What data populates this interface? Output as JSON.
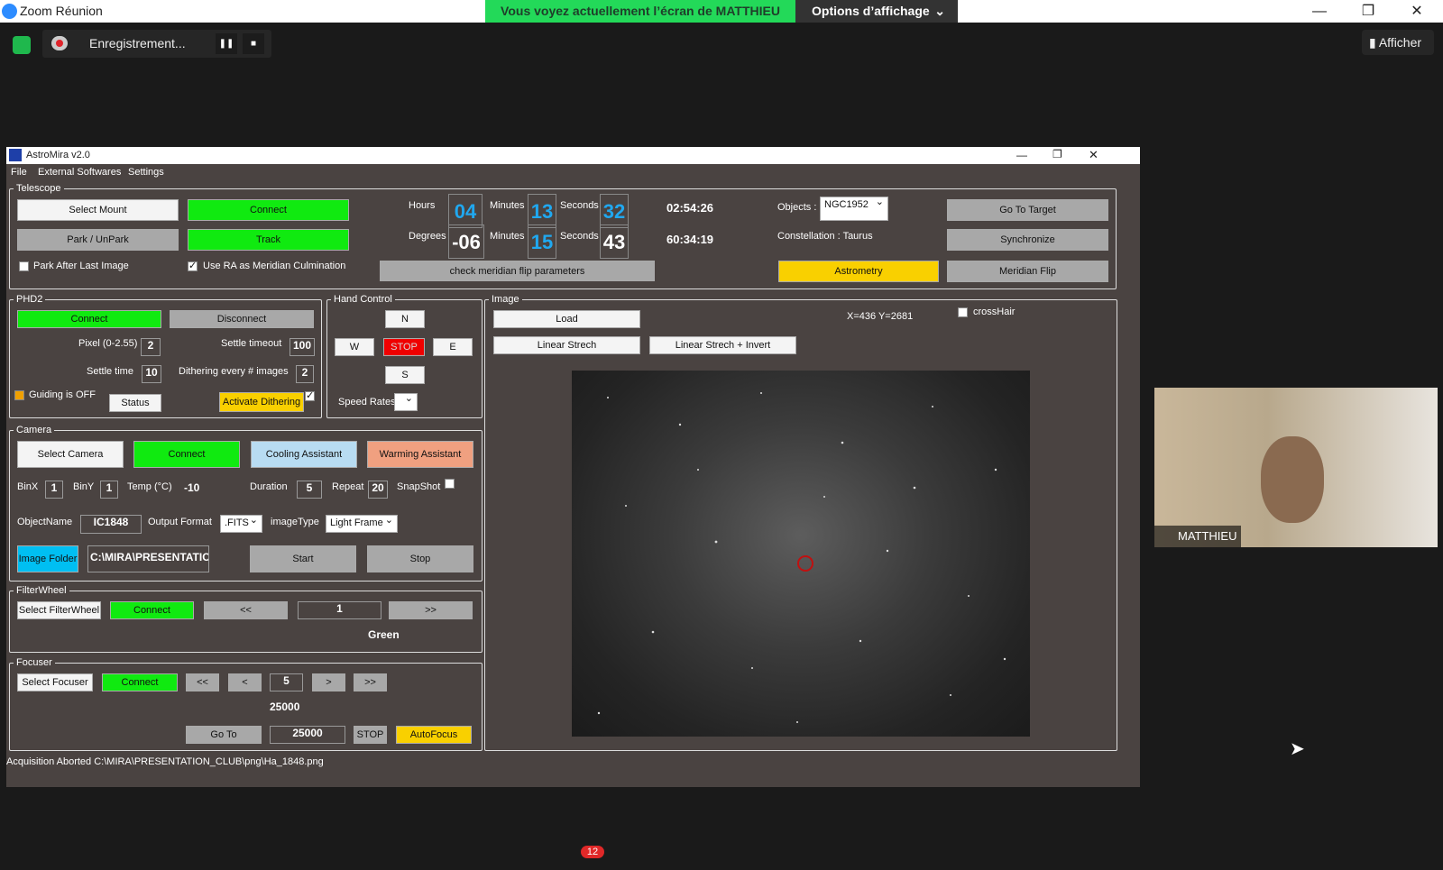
{
  "zoom": {
    "title": "Zoom Réunion",
    "banner": "Vous voyez actuellement l’écran de MATTHIEU",
    "options": "Options d’affichage",
    "recording": "Enregistrement...",
    "afficher": "Afficher",
    "participant": "MATTHIEU",
    "chat_badge": "12"
  },
  "app": {
    "title": "AstroMira v2.0",
    "menu": [
      "File",
      "External Softwares",
      "Settings"
    ],
    "telescope": {
      "legend": "Telescope",
      "select_mount": "Select Mount",
      "connect": "Connect",
      "park": "Park / UnPark",
      "track": "Track",
      "park_after": "Park After Last Image",
      "use_ra": "Use RA as Meridian Culmination",
      "hours_lbl": "Hours",
      "hours": "04",
      "minutes_lbl": "Minutes",
      "minutes": "13",
      "seconds_lbl": "Seconds",
      "seconds": "32",
      "degrees_lbl": "Degrees",
      "degrees": "-06",
      "dminutes": "15",
      "dseconds": "43",
      "ra": "02:54:26",
      "dec": "60:34:19",
      "check_flip": "check meridian flip parameters",
      "objects_lbl": "Objects :",
      "object": "NGC1952",
      "constellation": "Constellation : Taurus",
      "astrometry": "Astrometry",
      "goto_target": "Go To Target",
      "synchronize": "Synchronize",
      "meridian_flip": "Meridian Flip"
    },
    "phd2": {
      "legend": "PHD2",
      "connect": "Connect",
      "disconnect": "Disconnect",
      "pixel_lbl": "Pixel (0-2.55)",
      "pixel": "2",
      "settle_timeout_lbl": "Settle timeout",
      "settle_timeout": "100",
      "settle_time_lbl": "Settle time",
      "settle_time": "10",
      "dither_lbl": "Dithering every # images",
      "dither": "2",
      "guiding": "Guiding is OFF",
      "status": "Status",
      "activate_dither": "Activate Dithering"
    },
    "hand": {
      "legend": "Hand Control",
      "n": "N",
      "w": "W",
      "stop": "STOP",
      "e": "E",
      "s": "S",
      "speed_lbl": "Speed Rates"
    },
    "camera": {
      "legend": "Camera",
      "select": "Select Camera",
      "connect": "Connect",
      "cooling": "Cooling Assistant",
      "warming": "Warming Assistant",
      "binx_lbl": "BinX",
      "binx": "1",
      "biny_lbl": "BinY",
      "biny": "1",
      "temp_lbl": "Temp (°C)",
      "temp": "-10",
      "duration_lbl": "Duration",
      "duration": "5",
      "repeat_lbl": "Repeat",
      "repeat": "20",
      "snapshot_lbl": "SnapShot",
      "objname_lbl": "ObjectName",
      "objname": "IC1848",
      "format_lbl": "Output Format",
      "format": ".FITS",
      "imgtype_lbl": "imageType",
      "imgtype": "Light Frame",
      "folder_btn": "Image Folder",
      "folder": "C:\\MIRA\\PRESENTATIC",
      "start": "Start",
      "stop": "Stop"
    },
    "filter": {
      "legend": "FilterWheel",
      "select": "Select FilterWheel",
      "connect": "Connect",
      "prev": "<<",
      "pos": "1",
      "next": ">>",
      "name": "Green"
    },
    "focuser": {
      "legend": "Focuser",
      "select": "Select Focuser",
      "connect": "Connect",
      "ll": "<<",
      "l": "<",
      "step": "5",
      "r": ">",
      "rr": ">>",
      "pos": "25000",
      "goto": "Go To",
      "target": "25000",
      "stop": "STOP",
      "autofocus": "AutoFocus"
    },
    "image": {
      "legend": "Image",
      "load": "Load",
      "linear": "Linear Strech",
      "linear_inv": "Linear Strech + Invert",
      "coords": "X=436 Y=2681",
      "crosshair": "crossHair"
    },
    "status": "Acquisition Aborted  C:\\MIRA\\PRESENTATION_CLUB\\png\\Ha_1848.png"
  }
}
